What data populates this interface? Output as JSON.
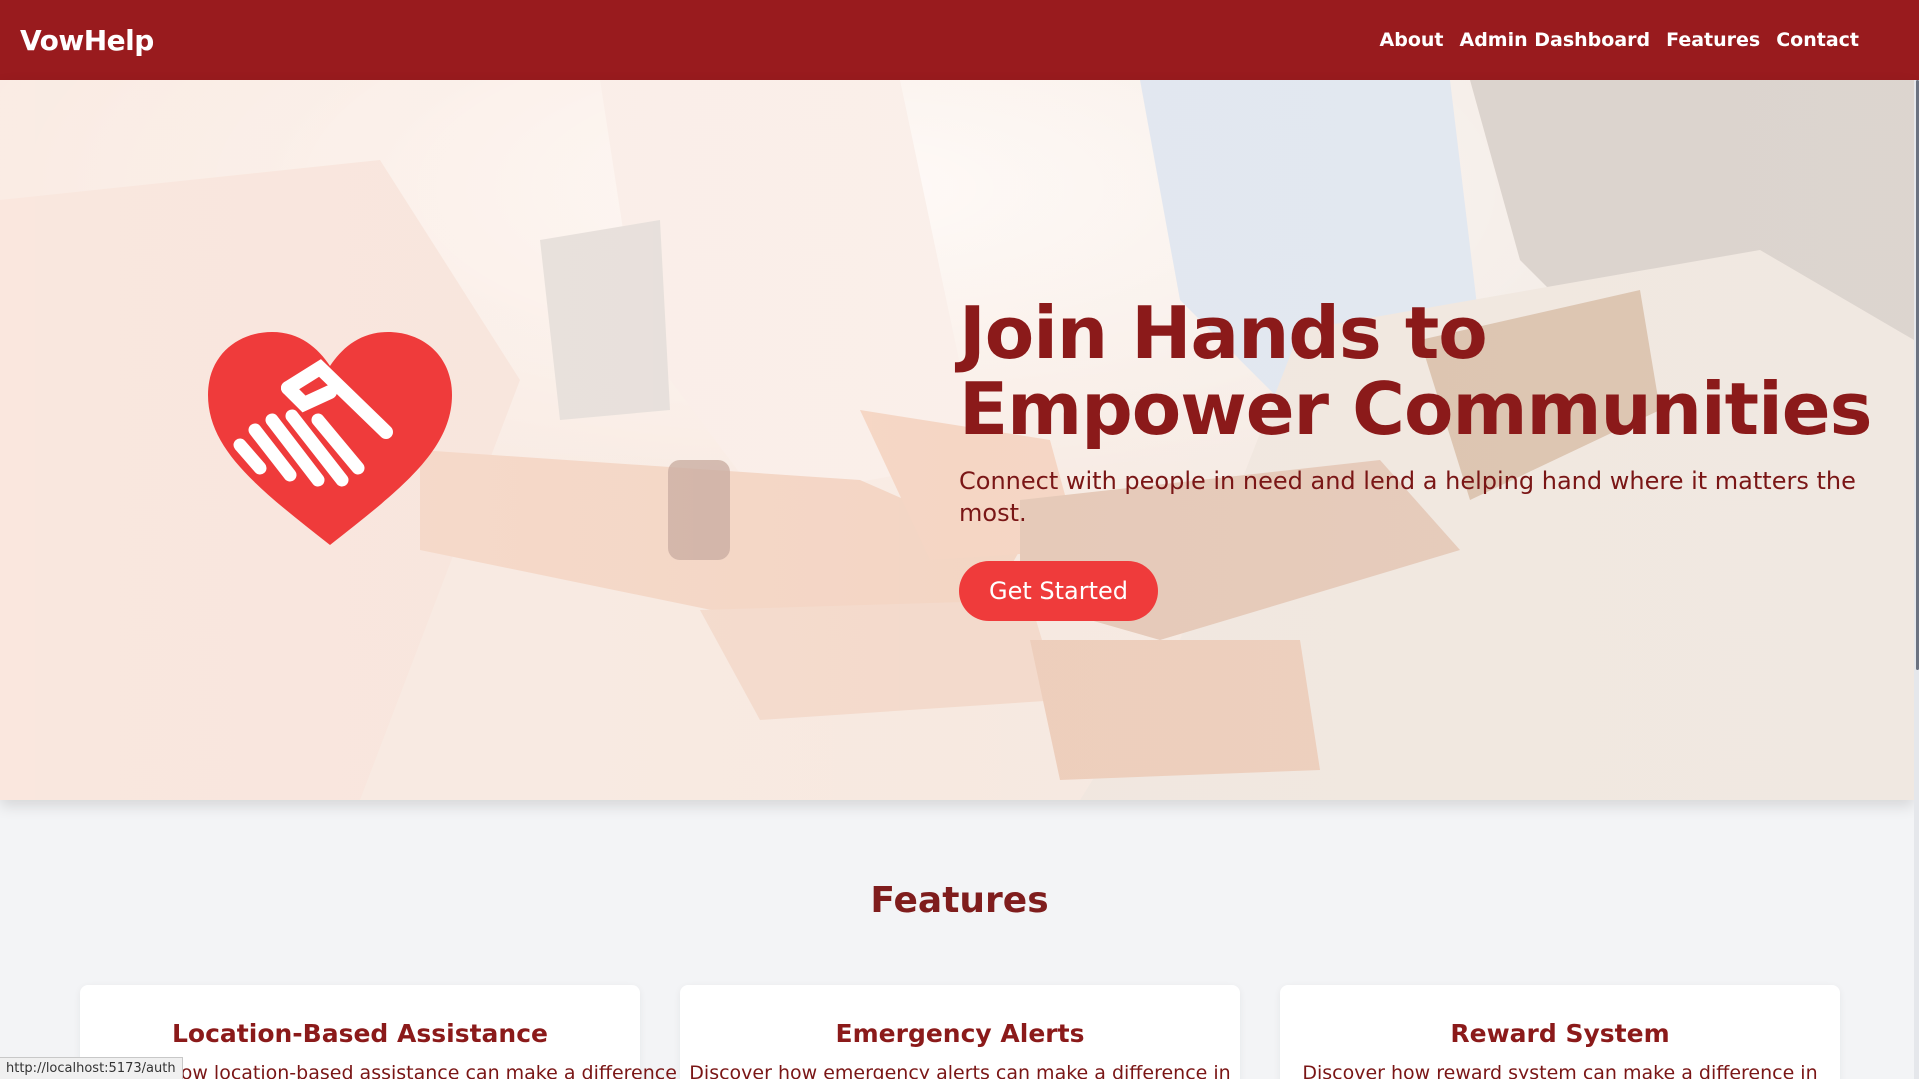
{
  "nav": {
    "brand": "VowHelp",
    "links": [
      "About",
      "Admin Dashboard",
      "Features",
      "Contact"
    ]
  },
  "hero": {
    "title": "Join Hands to Empower Communities",
    "subtitle": "Connect with people in need and lend a helping hand where it matters the most.",
    "cta_label": "Get Started",
    "logo_icon": "heart-handshake-icon",
    "background": "hands-together-photo"
  },
  "features": {
    "heading": "Features",
    "cards": [
      {
        "title": "Location-Based Assistance",
        "desc": "Discover how location-based assistance can make a difference in"
      },
      {
        "title": "Emergency Alerts",
        "desc": "Discover how emergency alerts can make a difference in"
      },
      {
        "title": "Reward System",
        "desc": "Discover how reward system can make a difference in"
      }
    ]
  },
  "status_bar": {
    "url": "http://localhost:5173/auth"
  },
  "colors": {
    "nav_bg": "#991b1e",
    "accent": "#ef3b3b",
    "heading": "#8b1a1a",
    "page_bg": "#f3f4f6"
  }
}
